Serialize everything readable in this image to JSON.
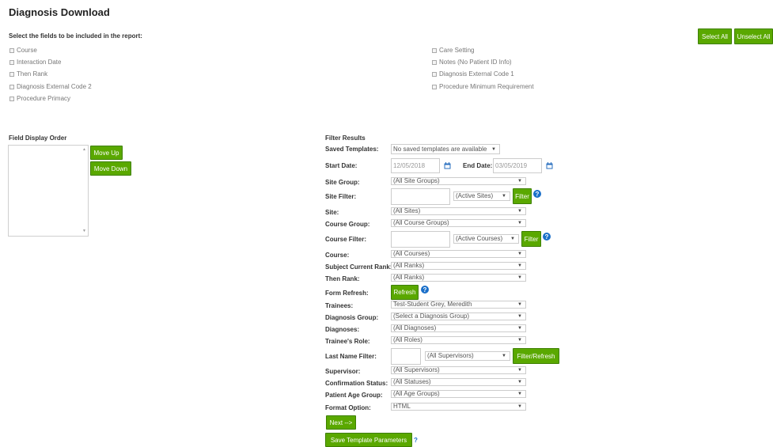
{
  "page": {
    "title": "Diagnosis Download",
    "instructions": "Select the fields to be included in the report:",
    "select_all": "Select All",
    "unselect_all": "Unselect All"
  },
  "fields_left": [
    "Course",
    "Interaction Date",
    "Then Rank",
    "Diagnosis External Code 2",
    "Procedure Primacy"
  ],
  "fields_right": [
    "Care Setting",
    "Notes (No Patient ID Info)",
    "Diagnosis External Code 1",
    "Procedure Minimum Requirement"
  ],
  "field_order": {
    "label": "Field Display Order",
    "move_up": "Move Up",
    "move_down": "Move Down"
  },
  "filter": {
    "heading": "Filter Results",
    "saved_templates": {
      "label": "Saved Templates:",
      "value": "No saved templates are available"
    },
    "start_date": {
      "label": "Start Date:",
      "value": "12/05/2018"
    },
    "end_date": {
      "label": "End Date:",
      "value": "03/05/2019"
    },
    "site_group": {
      "label": "Site Group:",
      "value": "(All Site Groups)"
    },
    "site_filter": {
      "label": "Site Filter:",
      "select": "(Active Sites)",
      "button": "Filter"
    },
    "site": {
      "label": "Site:",
      "value": "(All Sites)"
    },
    "course_group": {
      "label": "Course Group:",
      "value": "(All Course Groups)"
    },
    "course_filter": {
      "label": "Course Filter:",
      "select": "(Active Courses)",
      "button": "Filter"
    },
    "course": {
      "label": "Course:",
      "value": "(All Courses)"
    },
    "subject_rank": {
      "label": "Subject Current Rank:",
      "value": "(All Ranks)"
    },
    "then_rank": {
      "label": "Then Rank:",
      "value": "(All Ranks)"
    },
    "form_refresh": {
      "label": "Form Refresh:",
      "button": "Refresh"
    },
    "trainees": {
      "label": "Trainees:",
      "value": "Test-Student Grey, Meredith"
    },
    "diagnosis_group": {
      "label": "Diagnosis Group:",
      "value": "(Select a Diagnosis Group)"
    },
    "diagnoses": {
      "label": "Diagnoses:",
      "value": "(All Diagnoses)"
    },
    "trainee_role": {
      "label": "Trainee's Role:",
      "value": "(All Roles)"
    },
    "last_name_filter": {
      "label": "Last Name Filter:",
      "select": "(All Supervisors)",
      "button": "Filter/Refresh"
    },
    "supervisor": {
      "label": "Supervisor:",
      "value": "(All Supervisors)"
    },
    "confirmation_status": {
      "label": "Confirmation Status:",
      "value": "(All Statuses)"
    },
    "patient_age_group": {
      "label": "Patient Age Group:",
      "value": "(All Age Groups)"
    },
    "format_option": {
      "label": "Format Option:",
      "value": "HTML"
    },
    "next_button": "Next -->",
    "save_template_button": "Save Template Parameters",
    "save_template_help": "?"
  },
  "colors": {
    "accent": "#5aa800",
    "help": "#1a6fc9"
  },
  "icons": {
    "help": "question-circle-icon",
    "calendar": "calendar-icon",
    "caret": "caret-down-icon"
  }
}
